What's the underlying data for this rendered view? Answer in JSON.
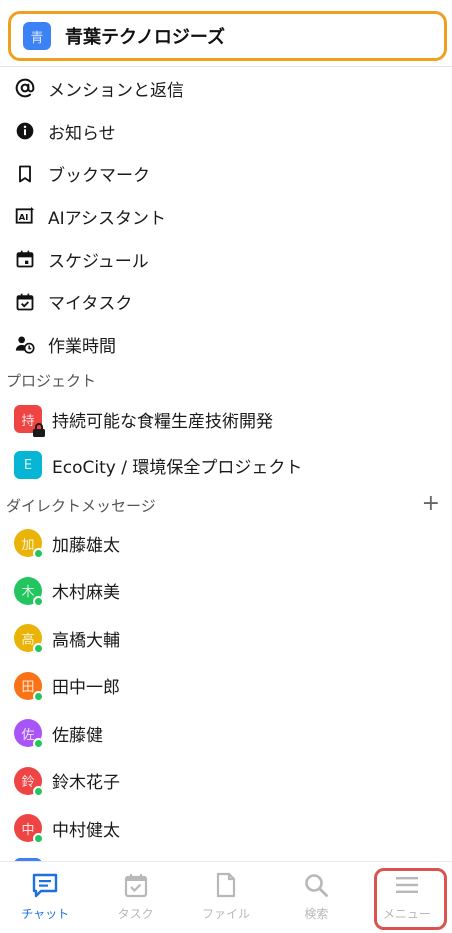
{
  "workspace": {
    "avatar": "青",
    "name": "青葉テクノロジーズ"
  },
  "menu": [
    {
      "label": "メンションと返信",
      "icon": "at-icon"
    },
    {
      "label": "お知らせ",
      "icon": "info-icon"
    },
    {
      "label": "ブックマーク",
      "icon": "bookmark-icon"
    },
    {
      "label": "AIアシスタント",
      "icon": "ai-assistant-icon"
    },
    {
      "label": "スケジュール",
      "icon": "calendar-icon"
    },
    {
      "label": "マイタスク",
      "icon": "task-icon"
    },
    {
      "label": "作業時間",
      "icon": "work-time-icon"
    }
  ],
  "projects": {
    "title": "プロジェクト",
    "items": [
      {
        "avatar": "持",
        "label": "持続可能な食糧生産技術開発",
        "color": "#ef4444",
        "locked": true
      },
      {
        "avatar": "E",
        "label": "EcoCity / 環境保全プロジェクト",
        "color": "#06b6d4",
        "locked": false
      }
    ]
  },
  "direct_messages": {
    "title": "ダイレクトメッセージ",
    "add": "+",
    "items": [
      {
        "avatar": "加",
        "label": "加藤雄太",
        "color": "#eab308"
      },
      {
        "avatar": "木",
        "label": "木村麻美",
        "color": "#22c55e"
      },
      {
        "avatar": "高",
        "label": "高橋大輔",
        "color": "#eab308"
      },
      {
        "avatar": "田",
        "label": "田中一郎",
        "color": "#f97316"
      },
      {
        "avatar": "佐",
        "label": "佐藤健",
        "color": "#a855f7"
      },
      {
        "avatar": "鈴",
        "label": "鈴木花子",
        "color": "#ef4444"
      },
      {
        "avatar": "中",
        "label": "中村健太",
        "color": "#ef4444"
      }
    ]
  },
  "tabs": [
    {
      "label": "チャット",
      "icon": "chat-icon",
      "active": true
    },
    {
      "label": "タスク",
      "icon": "task-tab-icon",
      "active": false
    },
    {
      "label": "ファイル",
      "icon": "file-icon",
      "active": false
    },
    {
      "label": "検索",
      "icon": "search-icon",
      "active": false
    },
    {
      "label": "メニュー",
      "icon": "menu-icon",
      "active": false
    }
  ],
  "colors": {
    "accent": "#1f6fe0",
    "workspace_highlight": "#f0a020",
    "menu_highlight": "#d9534f",
    "online": "#22c55e"
  }
}
